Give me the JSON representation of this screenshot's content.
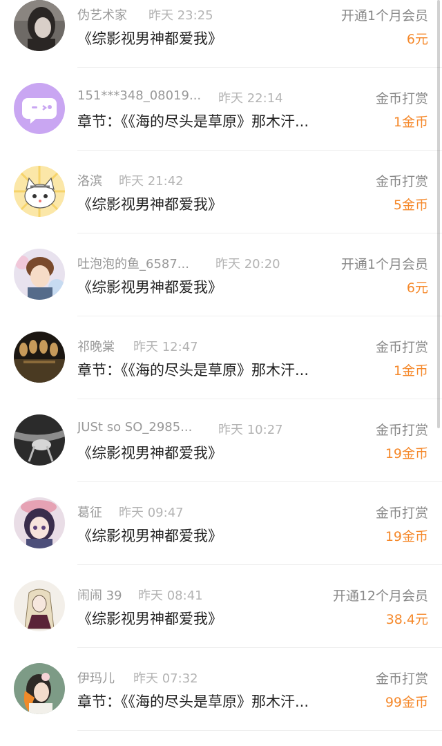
{
  "rows": [
    {
      "name": "伪艺术家",
      "time": "昨天 23:25",
      "type": "开通1个月会员",
      "title": "《综影视男神都爱我》",
      "amount": "6元",
      "avatar": "dark-portrait-avatar"
    },
    {
      "name": "151***348_08019...",
      "time": "昨天 22:14",
      "type": "金币打赏",
      "title": "章节：《《海的尽头是草原》那木汗...",
      "amount": "1金币",
      "avatar": "chat-bubble-avatar"
    },
    {
      "name": "洛滨",
      "time": "昨天 21:42",
      "type": "金币打赏",
      "title": "《综影视男神都爱我》",
      "amount": "5金币",
      "avatar": "cat-avatar"
    },
    {
      "name": "吐泡泡的鱼_6587...",
      "time": "昨天 20:20",
      "type": "开通1个月会员",
      "title": "《综影视男神都爱我》",
      "amount": "6元",
      "avatar": "anime-boy-avatar"
    },
    {
      "name": "祁晚棠",
      "time": "昨天 12:47",
      "type": "金币打赏",
      "title": "章节：《《海的尽头是草原》那木汗...",
      "amount": "1金币",
      "avatar": "stage-avatar"
    },
    {
      "name": "JUSt so SO_2985...",
      "time": "昨天 10:27",
      "type": "金币打赏",
      "title": "《综影视男神都爱我》",
      "amount": "19金币",
      "avatar": "bw-photo-avatar"
    },
    {
      "name": "葛征",
      "time": "昨天 09:47",
      "type": "金币打赏",
      "title": "《综影视男神都爱我》",
      "amount": "19金币",
      "avatar": "anime-girl-avatar"
    },
    {
      "name": "闹闹 39",
      "time": "昨天 08:41",
      "type": "开通12个月会员",
      "title": "《综影视男神都爱我》",
      "amount": "38.4元",
      "avatar": "rapunzel-avatar"
    },
    {
      "name": "伊玛儿",
      "time": "昨天 07:32",
      "type": "金币打赏",
      "title": "章节：《《海的尽头是草原》那木汗...",
      "amount": "99金币",
      "avatar": "girl-flower-avatar"
    }
  ]
}
